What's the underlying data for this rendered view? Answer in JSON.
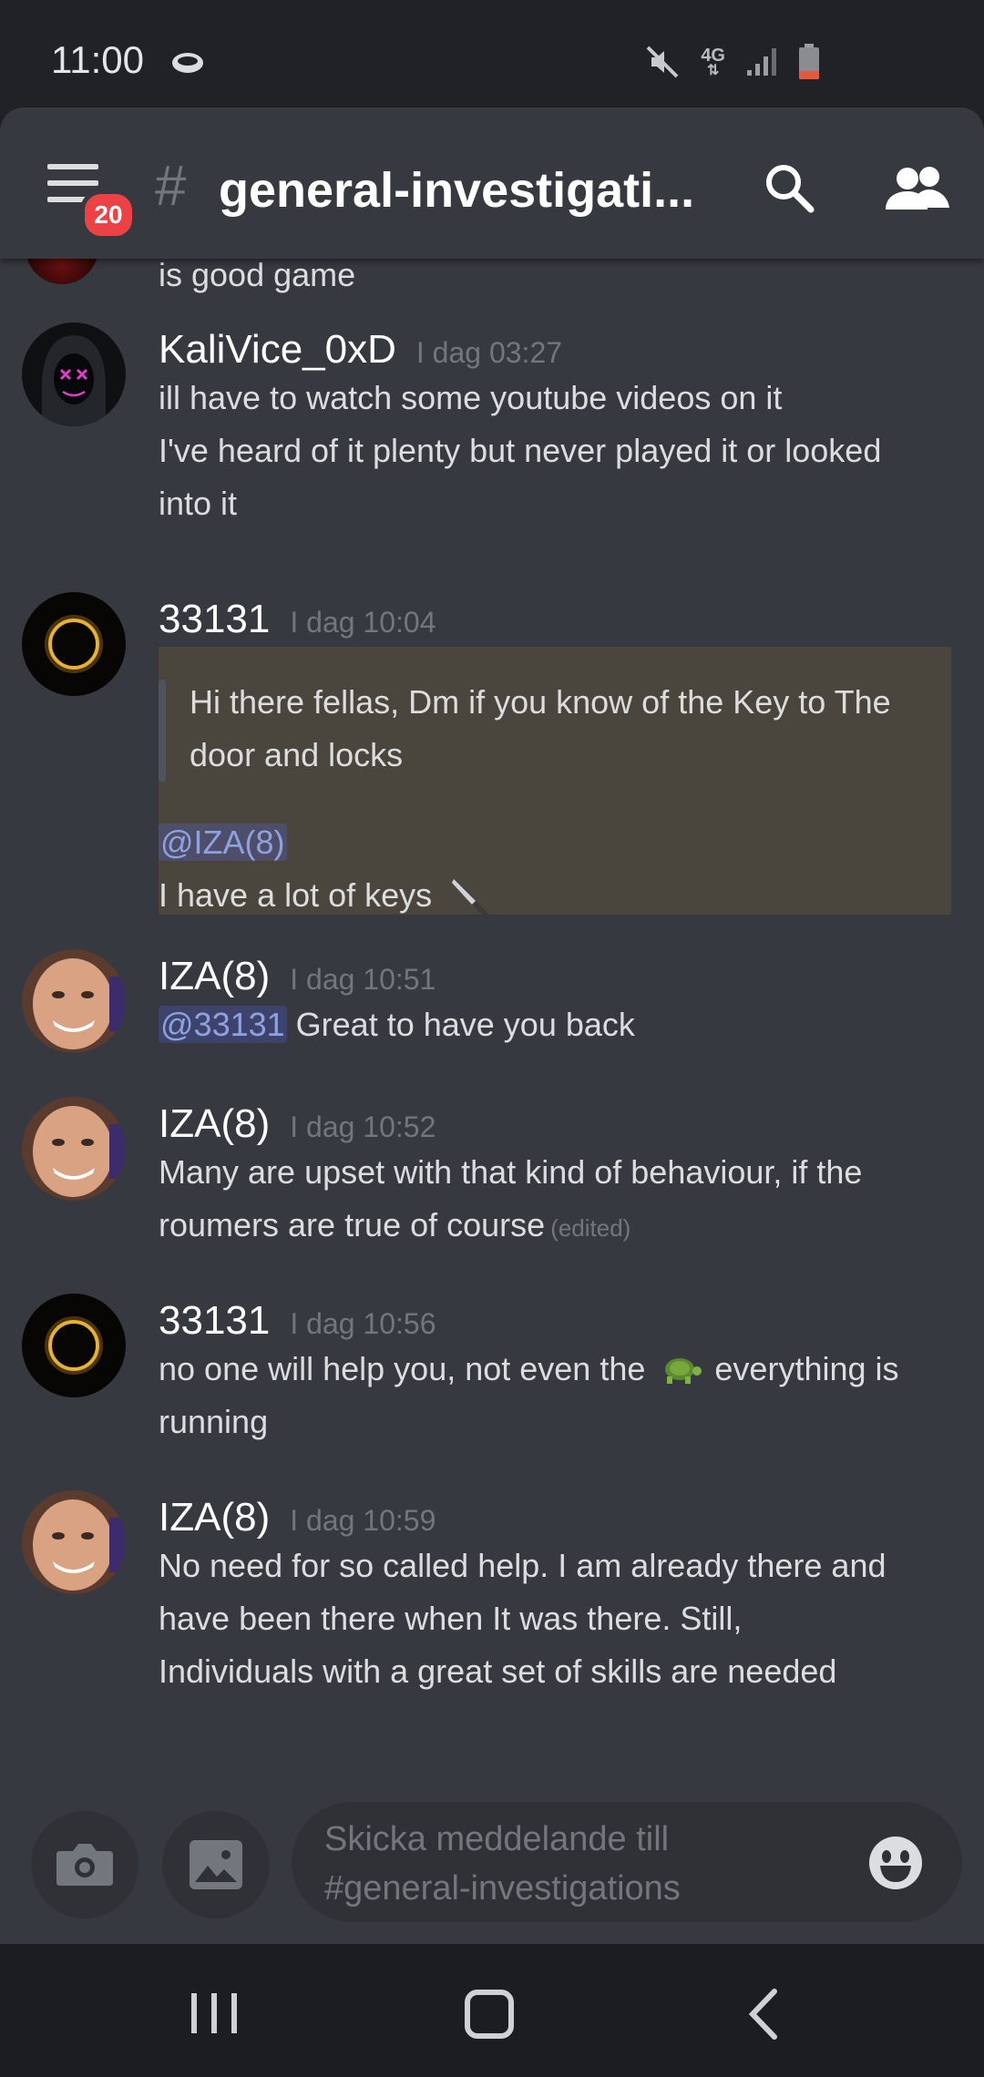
{
  "status_bar": {
    "time": "11:00",
    "network": "4G",
    "icons": [
      "cloud-icon",
      "mute-icon",
      "4g-icon",
      "signal-icon",
      "battery-low-icon"
    ]
  },
  "header": {
    "unread_badge": "20",
    "hash": "#",
    "channel_title": "general-investigati...",
    "icons": [
      "menu-icon",
      "search-icon",
      "members-icon"
    ]
  },
  "chat": {
    "partial_message": "is good game",
    "messages": [
      {
        "author": "KaliVice_0xD",
        "time": "I dag 03:27",
        "lines": [
          "ill have to watch some youtube videos on it",
          "I've heard of it plenty but never played it or looked",
          "into it"
        ]
      },
      {
        "author": "33131",
        "time": "I dag 10:04",
        "quote_lines": [
          "Hi there fellas, Dm if you know of the Key to The",
          "door and locks"
        ],
        "mention": "@IZA(8)",
        "reply_text": "I have a lot of keys"
      },
      {
        "author": "IZA(8)",
        "time": "I dag 10:51",
        "mention": "@33131",
        "text": "Great to have you back"
      },
      {
        "author": "IZA(8)",
        "time": "I dag 10:52",
        "lines": [
          "Many are upset with that kind of behaviour, if the",
          "roumers are true of course"
        ],
        "edited": "(edited)"
      },
      {
        "author": "33131",
        "time": "I dag 10:56",
        "text_before_emoji": "no one will help you, not even the",
        "text_after_emoji": "everything is",
        "line2": "running"
      },
      {
        "author": "IZA(8)",
        "time": "I dag 10:59",
        "lines": [
          "No need for so called help. I am already there and",
          "have been there when It was there. Still,",
          "Individuals with a great set of skills are needed"
        ]
      }
    ]
  },
  "composer": {
    "placeholder_line1": "Skicka meddelande till",
    "placeholder_line2": "#general-investigations",
    "icons": [
      "camera-icon",
      "image-icon",
      "emoji-icon"
    ]
  },
  "nav": {
    "icons": [
      "recents-icon",
      "home-icon",
      "back-icon"
    ]
  },
  "colors": {
    "background": "#36393f",
    "mention": "#8ea1e1",
    "badge": "#ed4245",
    "highlight": "#4b463d"
  }
}
